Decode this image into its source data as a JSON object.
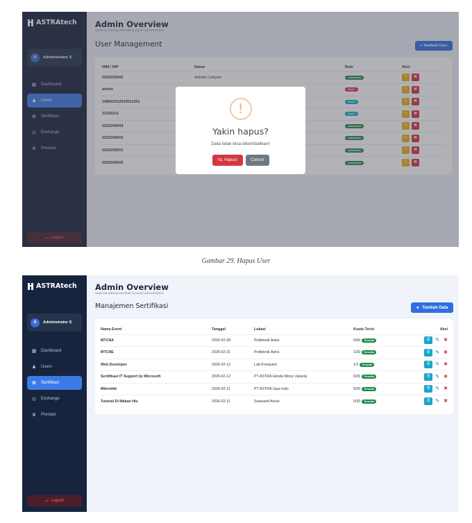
{
  "screen1": {
    "brand": "ASTRAtech",
    "profile": {
      "initial": "A",
      "name": "Administrator S"
    },
    "menu": [
      {
        "label": "Dashboard",
        "icon": "grid-icon"
      },
      {
        "label": "Users",
        "icon": "users-icon"
      },
      {
        "label": "Sertifikasi",
        "icon": "cert-icon"
      },
      {
        "label": "Exchange",
        "icon": "globe-icon"
      },
      {
        "label": "Prestasi",
        "icon": "trophy-icon"
      }
    ],
    "logout": "Logout",
    "title": "Admin Overview",
    "subtitle": "Selamat datang kembali di panel administrator.",
    "section": "User Management",
    "add_button": "+ Tambah User",
    "table": {
      "headers": [
        "NIM / NIP",
        "Nama",
        "Role",
        "Aksi"
      ],
      "rows": [
        {
          "id": "0320230002",
          "name": "Adinda Cahyani",
          "role": "mahasiswa"
        },
        {
          "id": "admin",
          "name": "",
          "role": "admin"
        },
        {
          "id": "198501012010011001",
          "name": "",
          "role": "dosen"
        },
        {
          "id": "31030211",
          "name": "",
          "role": "dosen"
        },
        {
          "id": "0320240004",
          "name": "",
          "role": "mahasiswa"
        },
        {
          "id": "0320240003",
          "name": "",
          "role": "mahasiswa"
        },
        {
          "id": "0320230001",
          "name": "",
          "role": "mahasiswa"
        },
        {
          "id": "0320240005",
          "name": "",
          "role": "mahasiswa"
        }
      ]
    },
    "modal": {
      "title": "Yakin hapus?",
      "text": "Data tidak bisa dikembalikan!",
      "confirm": "Ya, Hapus!",
      "cancel": "Cancel"
    }
  },
  "caption1": "Gambar 29. Hapus User",
  "screen2": {
    "brand": "ASTRAtech",
    "profile": {
      "initial": "A",
      "name": "Administrator S"
    },
    "menu": [
      {
        "label": "Dashboard",
        "icon": "grid-icon"
      },
      {
        "label": "Users",
        "icon": "users-icon"
      },
      {
        "label": "Sertifikasi",
        "icon": "cert-icon"
      },
      {
        "label": "Exchange",
        "icon": "globe-icon"
      },
      {
        "label": "Prestasi",
        "icon": "trophy-icon"
      }
    ],
    "logout": "Logout",
    "title": "Admin Overview",
    "subtitle": "Selamat datang kembali di panel administrator.",
    "section": "Manajemen Sertifikasi",
    "add_button": "Tambah Data",
    "table": {
      "headers": [
        "Nama Event",
        "Tanggal",
        "Lokasi",
        "Kuota Terisi",
        "Aksi"
      ],
      "rows": [
        {
          "name": "MTCNA",
          "date": "2026-02-28",
          "location": "Politeknik Astra",
          "quota": "0/50",
          "status": "Tersedia"
        },
        {
          "name": "MTCNE",
          "date": "2026-02-21",
          "location": "Politeknik Astra",
          "quota": "1/20",
          "status": "Tersedia"
        },
        {
          "name": "Web Developer",
          "date": "2026-02-12",
          "location": "Lab Komputer",
          "quota": "1/2",
          "status": "Tersedia"
        },
        {
          "name": "Sertifikasi IT Support by Microsoft",
          "date": "2026-02-12",
          "location": "PT ASTRA Honda Motor Jakarta",
          "quota": "0/20",
          "status": "Tersedia"
        },
        {
          "name": "Mikrotikk",
          "date": "2026-02-11",
          "location": "PT ASTRA Jaya Indo",
          "quota": "0/20",
          "status": "Tersedia"
        },
        {
          "name": "Tutorial Di Makan Hiu",
          "date": "2026-02-11",
          "location": "Seawarld Ancol",
          "quota": "0/20",
          "status": "Tersedia"
        }
      ]
    }
  },
  "colors": {
    "sidebar": "#17243d",
    "accent": "#3d7ae6",
    "danger": "#d63344",
    "success": "#1e8a4c"
  }
}
